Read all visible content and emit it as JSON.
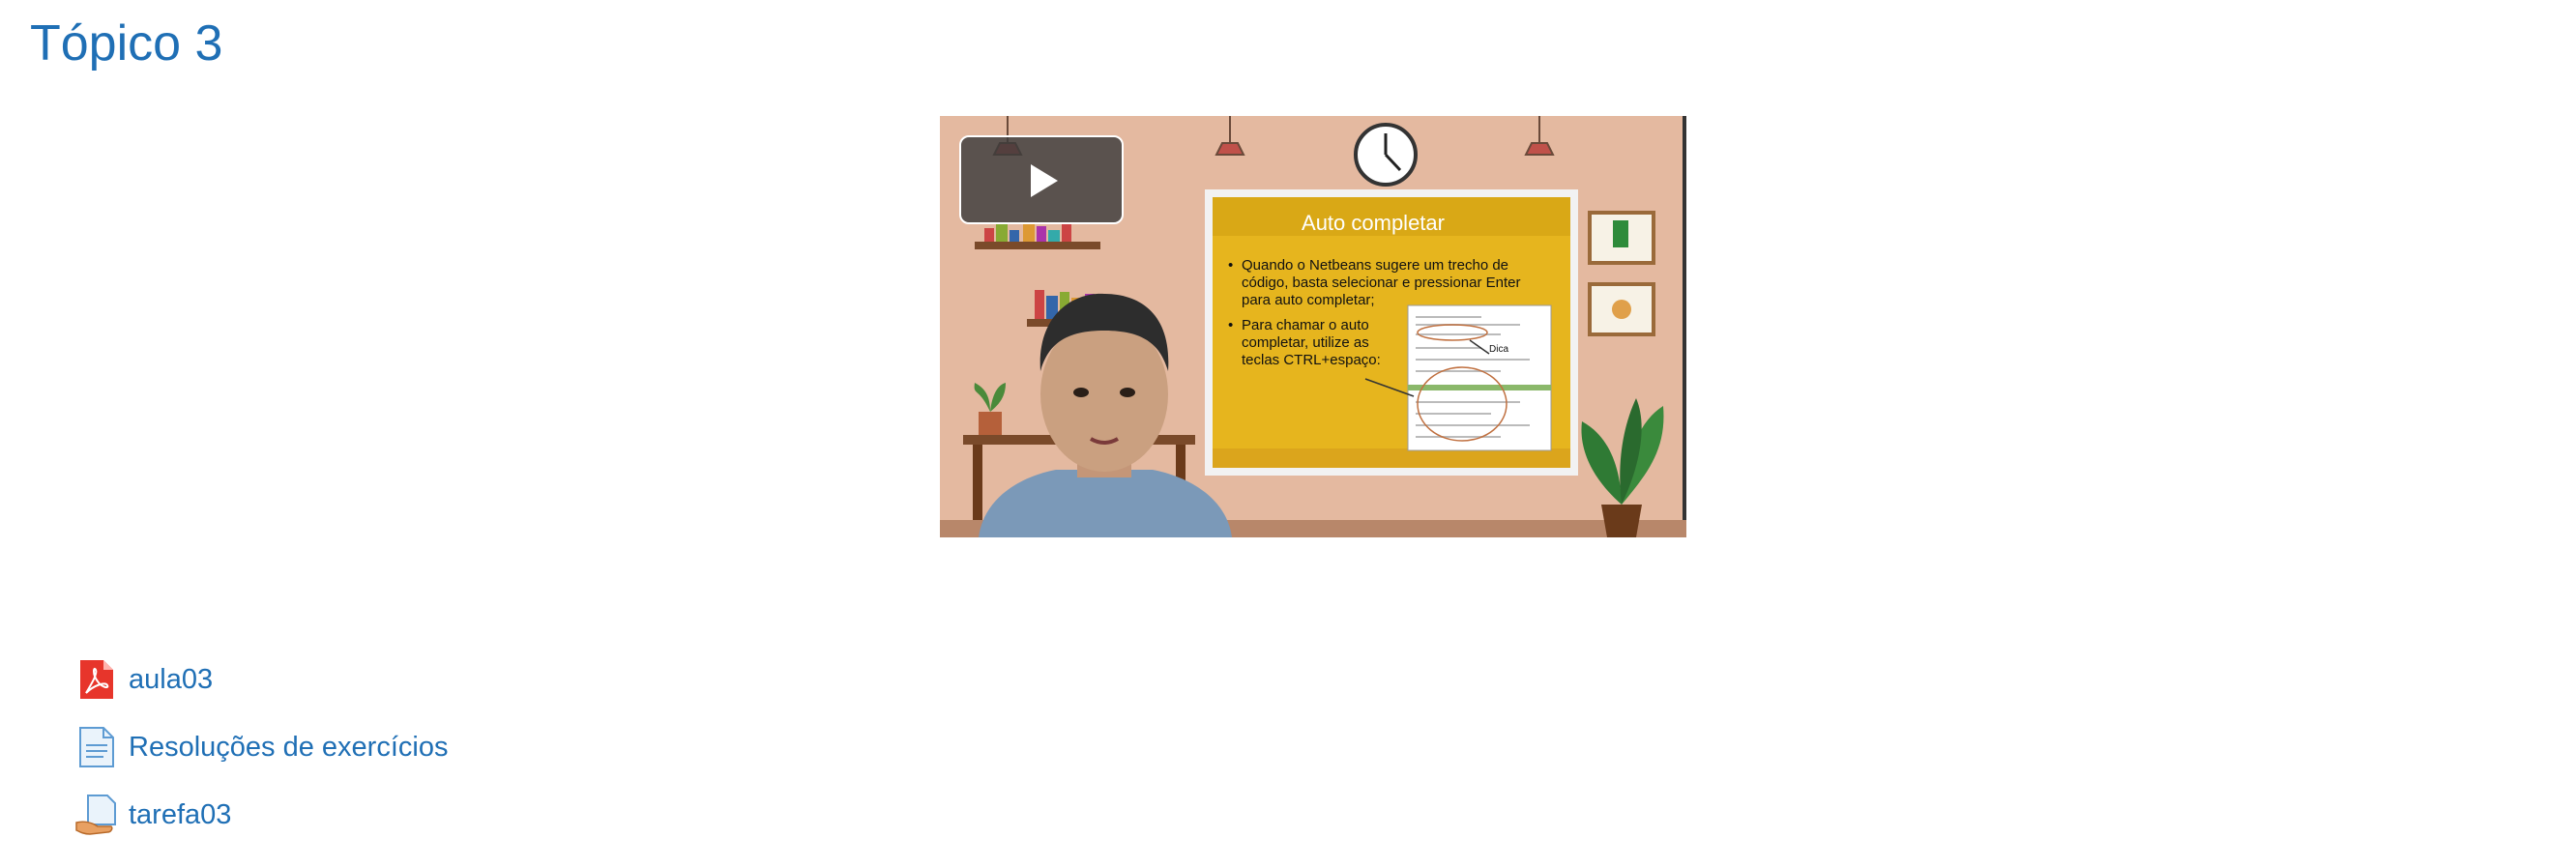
{
  "section": {
    "title": "Tópico 3"
  },
  "video": {
    "slide_title": "Auto completar",
    "bullets": [
      "Quando o Netbeans sugere um trecho de código, basta selecionar e pressionar Enter para auto completar;",
      "Para chamar o auto completar, utilize as teclas CTRL+espaço:"
    ],
    "annotation": "Dica",
    "play_icon": "play-icon"
  },
  "activities": [
    {
      "label": "aula03",
      "icon": "pdf-icon"
    },
    {
      "label": "Resoluções de exercícios",
      "icon": "page-icon"
    },
    {
      "label": "tarefa03",
      "icon": "assignment-icon"
    }
  ],
  "colors": {
    "link": "#1f6fb5",
    "wall": "#e4b9a0",
    "board": "#e6b51e"
  }
}
